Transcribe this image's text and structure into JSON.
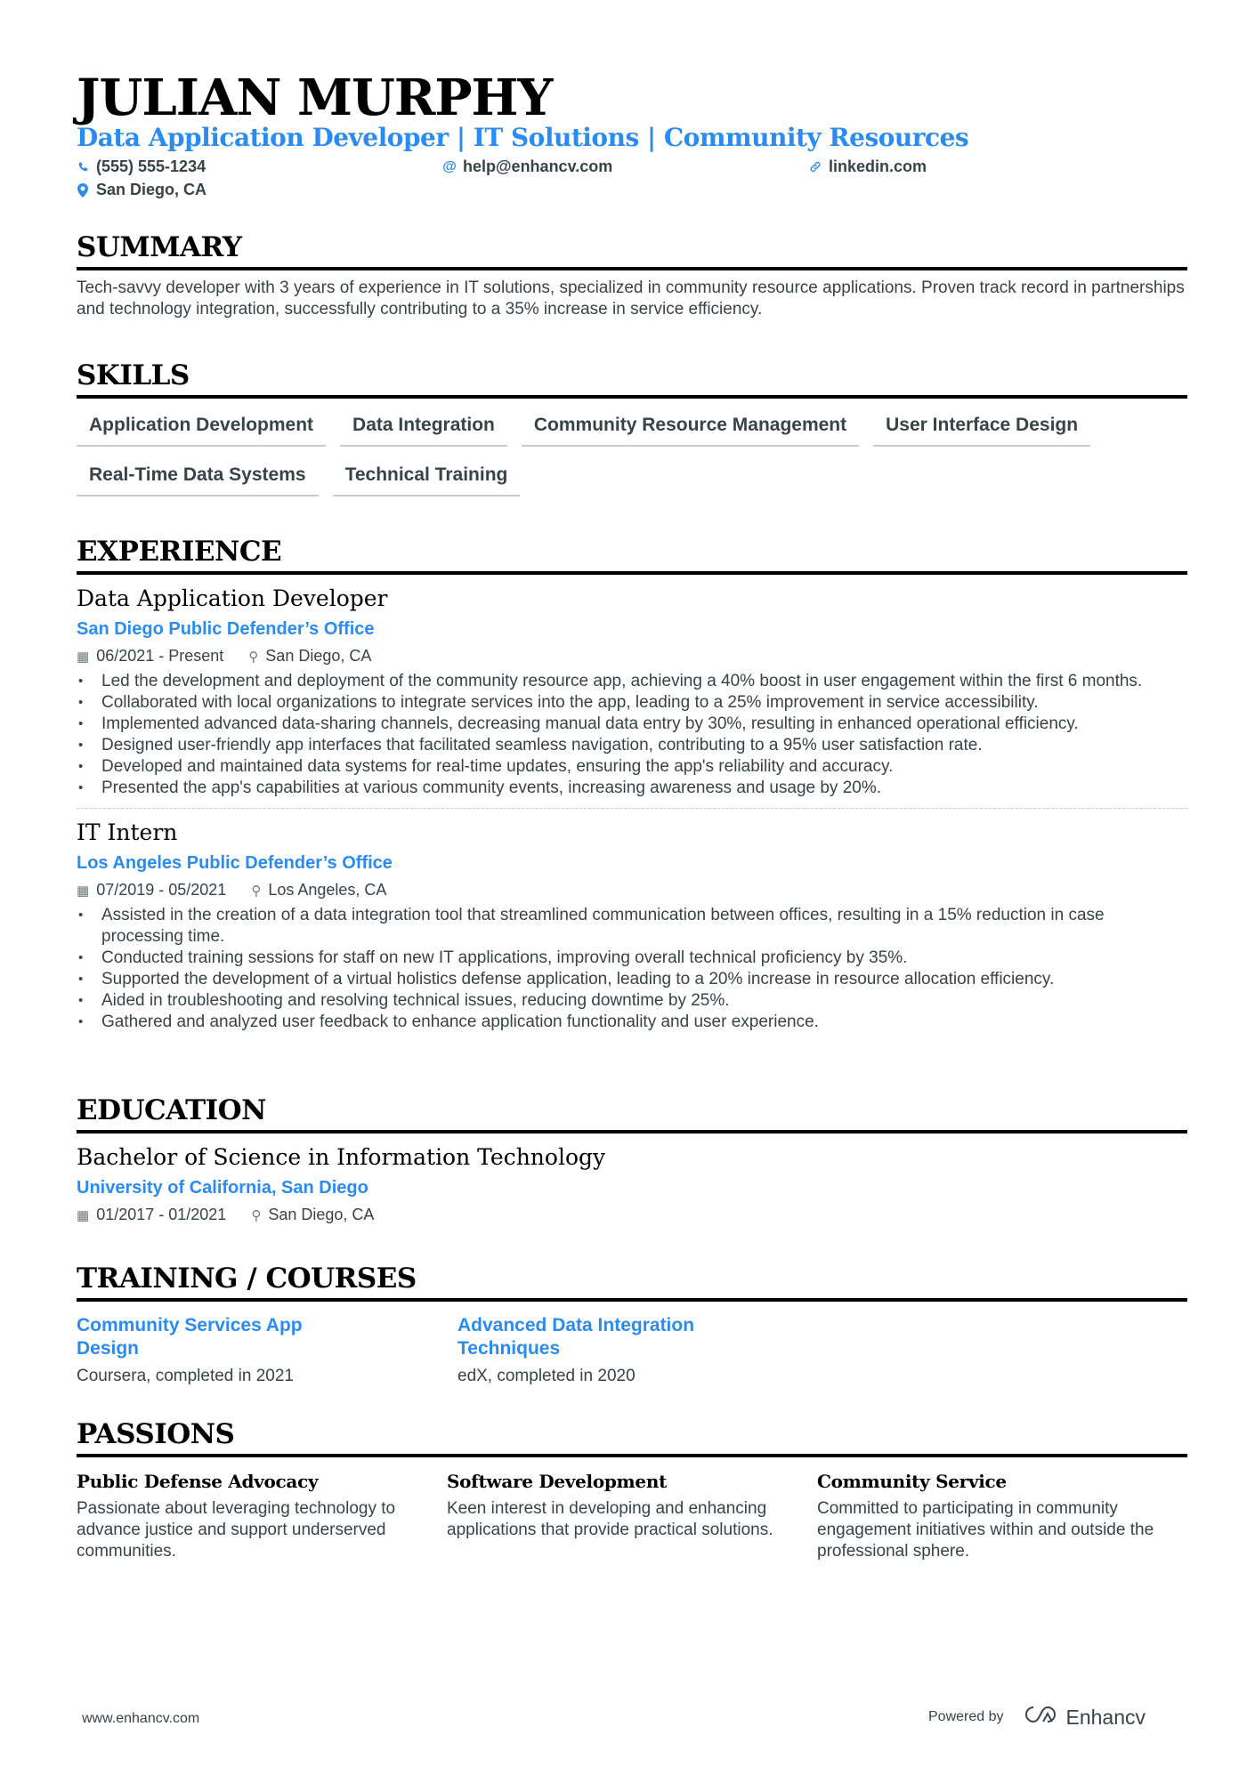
{
  "header": {
    "name": "JULIAN MURPHY",
    "headline": "Data Application Developer | IT Solutions | Community Resources",
    "contacts": {
      "phone": "(555) 555-1234",
      "email": "help@enhancv.com",
      "website": "linkedin.com",
      "location": "San Diego, CA"
    }
  },
  "summary": {
    "title": "SUMMARY",
    "text": "Tech-savvy developer with 3 years of experience in IT solutions, specialized in community resource applications. Proven track record in partnerships and technology integration, successfully contributing to a 35% increase in service efficiency."
  },
  "skills": {
    "title": "SKILLS",
    "items": [
      "Application Development",
      "Data Integration",
      "Community Resource Management",
      "User Interface Design",
      "Real-Time Data Systems",
      "Technical Training"
    ]
  },
  "experience": {
    "title": "EXPERIENCE",
    "jobs": [
      {
        "title": "Data Application Developer",
        "company": "San Diego Public Defender’s Office",
        "dates": "06/2021 - Present",
        "location": "San Diego, CA",
        "bullets": [
          "Led the development and deployment of the community resource app, achieving a 40% boost in user engagement within the first 6 months.",
          "Collaborated with local organizations to integrate services into the app, leading to a 25% improvement in service accessibility.",
          "Implemented advanced data-sharing channels, decreasing manual data entry by 30%, resulting in enhanced operational efficiency.",
          "Designed user-friendly app interfaces that facilitated seamless navigation, contributing to a 95% user satisfaction rate.",
          "Developed and maintained data systems for real-time updates, ensuring the app's reliability and accuracy.",
          "Presented the app's capabilities at various community events, increasing awareness and usage by 20%."
        ]
      },
      {
        "title": "IT Intern",
        "company": "Los Angeles Public Defender’s Office",
        "dates": "07/2019 - 05/2021",
        "location": "Los Angeles, CA",
        "bullets": [
          "Assisted in the creation of a data integration tool that streamlined communication between offices, resulting in a 15% reduction in case processing time.",
          "Conducted training sessions for staff on new IT applications, improving overall technical proficiency by 35%.",
          "Supported the development of a virtual holistics defense application, leading to a 20% increase in resource allocation efficiency.",
          "Aided in troubleshooting and resolving technical issues, reducing downtime by 25%.",
          "Gathered and analyzed user feedback to enhance application functionality and user experience."
        ]
      }
    ]
  },
  "education": {
    "title": "EDUCATION",
    "degree": "Bachelor of Science in Information Technology",
    "school": "University of California, San Diego",
    "dates": "01/2017 - 01/2021",
    "location": "San Diego, CA"
  },
  "training": {
    "title": "TRAINING / COURSES",
    "courses": [
      {
        "title": "Community Services App Design",
        "provider": "Coursera, completed in 2021"
      },
      {
        "title": "Advanced Data Integration Techniques",
        "provider": "edX, completed in 2020"
      }
    ]
  },
  "passions": {
    "title": "PASSIONS",
    "items": [
      {
        "title": "Public Defense Advocacy",
        "desc": "Passionate about leveraging technology to advance justice and support underserved communities."
      },
      {
        "title": "Software Development",
        "desc": "Keen interest in developing and enhancing applications that provide practical solutions."
      },
      {
        "title": "Community Service",
        "desc": "Committed to participating in community engagement initiatives within and outside the professional sphere."
      }
    ]
  },
  "footer": {
    "website": "www.enhancv.com",
    "powered_by": "Powered by",
    "brand": "Enhancv"
  },
  "colors": {
    "accent": "#2a8cf0",
    "text": "#384347",
    "heading": "#000000"
  },
  "icons": {
    "phone": "phone-icon",
    "email": "at-icon",
    "website": "link-icon",
    "location": "map-pin-icon",
    "date": "calendar-icon"
  }
}
